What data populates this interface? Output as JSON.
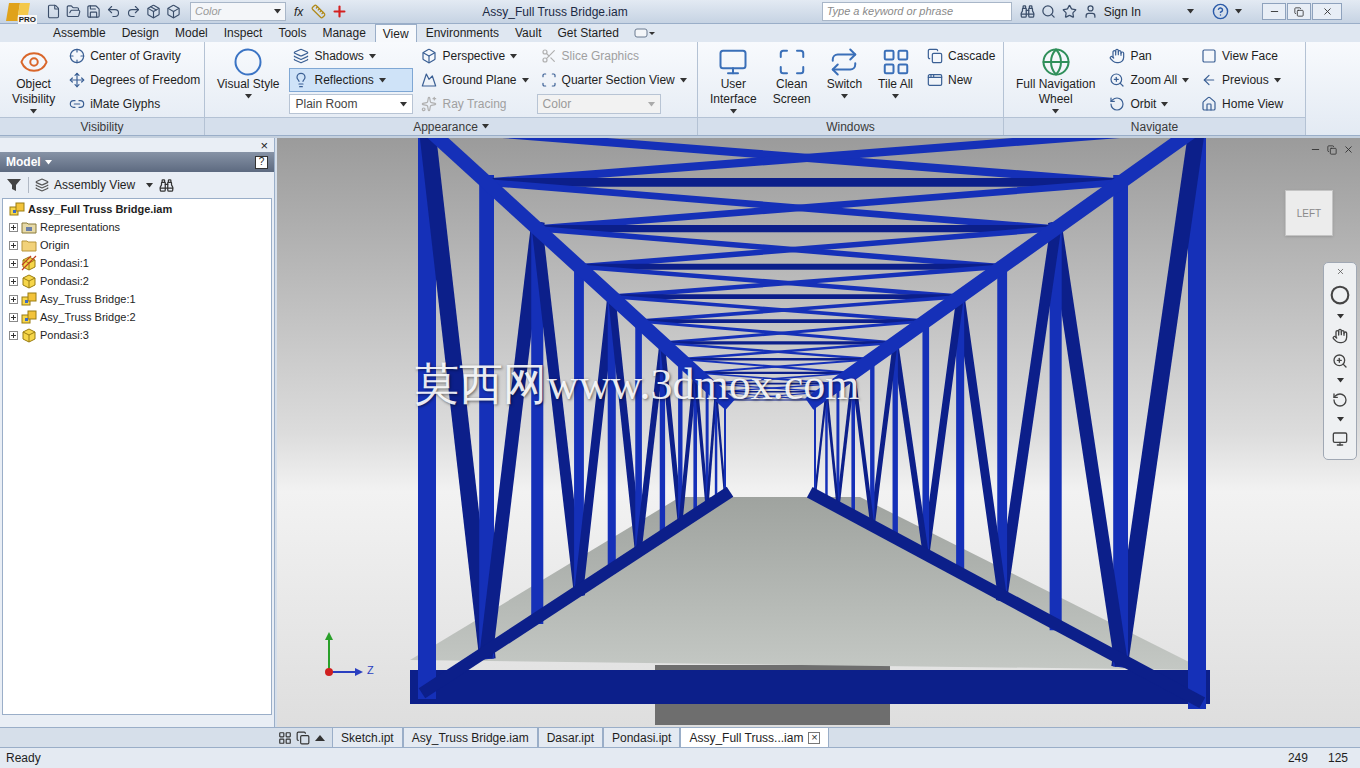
{
  "window": {
    "title": "Assy_Full Truss Bridge.iam",
    "app_badge": "PRO"
  },
  "quick_access": {
    "style_field": "Color",
    "function_label": "fx"
  },
  "search": {
    "placeholder": "Type a keyword or phrase"
  },
  "account": {
    "label": "Sign In"
  },
  "menu_tabs": [
    {
      "label": "Assemble",
      "selected": false
    },
    {
      "label": "Design",
      "selected": false
    },
    {
      "label": "Model",
      "selected": false
    },
    {
      "label": "Inspect",
      "selected": false
    },
    {
      "label": "Tools",
      "selected": false
    },
    {
      "label": "Manage",
      "selected": false
    },
    {
      "label": "View",
      "selected": true
    },
    {
      "label": "Environments",
      "selected": false
    },
    {
      "label": "Vault",
      "selected": false
    },
    {
      "label": "Get Started",
      "selected": false
    }
  ],
  "ribbon": {
    "panels": [
      {
        "label": "Visibility",
        "dropdown": false,
        "columns": [
          [
            {
              "kind": "large",
              "lines": [
                "Object",
                "Visibility"
              ],
              "dropdown": true,
              "active": false,
              "disabled": false
            }
          ],
          [
            {
              "kind": "small",
              "label": "Center of Gravity",
              "dropdown": false,
              "active": false,
              "disabled": false
            },
            {
              "kind": "small",
              "label": "Degrees of Freedom",
              "dropdown": false,
              "active": false,
              "disabled": false
            },
            {
              "kind": "small",
              "label": "iMate Glyphs",
              "dropdown": false,
              "active": false,
              "disabled": false
            }
          ]
        ]
      },
      {
        "label": "Appearance",
        "dropdown": true,
        "columns": [
          [
            {
              "kind": "large",
              "lines": [
                "Visual Style"
              ],
              "dropdown": true,
              "active": false,
              "disabled": false
            }
          ],
          [
            {
              "kind": "small",
              "label": "Shadows",
              "dropdown": true,
              "active": false,
              "disabled": false
            },
            {
              "kind": "small",
              "label": "Reflections",
              "dropdown": true,
              "active": true,
              "disabled": false
            },
            {
              "kind": "select",
              "label": "Plain Room",
              "dropdown": true,
              "active": false,
              "disabled": false
            }
          ],
          [
            {
              "kind": "small",
              "label": "Perspective",
              "dropdown": true,
              "active": false,
              "disabled": false
            },
            {
              "kind": "small",
              "label": "Ground Plane",
              "dropdown": true,
              "active": false,
              "disabled": false
            },
            {
              "kind": "small",
              "label": "Ray Tracing",
              "dropdown": false,
              "active": false,
              "disabled": true
            }
          ],
          [
            {
              "kind": "small",
              "label": "Slice Graphics",
              "dropdown": false,
              "active": false,
              "disabled": true
            },
            {
              "kind": "small",
              "label": "Quarter Section View",
              "dropdown": true,
              "active": false,
              "disabled": false
            },
            {
              "kind": "select",
              "label": "Color",
              "dropdown": true,
              "active": false,
              "disabled": true
            }
          ]
        ]
      },
      {
        "label": "Windows",
        "dropdown": false,
        "columns": [
          [
            {
              "kind": "large",
              "lines": [
                "User",
                "Interface"
              ],
              "dropdown": true,
              "active": false,
              "disabled": false
            }
          ],
          [
            {
              "kind": "large",
              "lines": [
                "Clean",
                "Screen"
              ],
              "dropdown": false,
              "active": false,
              "disabled": false
            }
          ],
          [
            {
              "kind": "large",
              "lines": [
                "Switch"
              ],
              "dropdown": true,
              "active": false,
              "disabled": false
            }
          ],
          [
            {
              "kind": "large",
              "lines": [
                "Tile All"
              ],
              "dropdown": true,
              "active": false,
              "disabled": false
            }
          ],
          [
            {
              "kind": "small",
              "label": "Cascade",
              "dropdown": false,
              "active": false,
              "disabled": false
            },
            {
              "kind": "small",
              "label": "New",
              "dropdown": false,
              "active": false,
              "disabled": false
            }
          ]
        ]
      },
      {
        "label": "Navigate",
        "dropdown": false,
        "columns": [
          [
            {
              "kind": "large",
              "lines": [
                "Full Navigation",
                "Wheel"
              ],
              "dropdown": true,
              "active": false,
              "disabled": false
            }
          ],
          [
            {
              "kind": "small",
              "label": "Pan",
              "dropdown": false,
              "active": false,
              "disabled": false
            },
            {
              "kind": "small",
              "label": "Zoom All",
              "dropdown": true,
              "active": false,
              "disabled": false
            },
            {
              "kind": "small",
              "label": "Orbit",
              "dropdown": true,
              "active": false,
              "disabled": false
            }
          ],
          [
            {
              "kind": "small",
              "label": "View Face",
              "dropdown": false,
              "active": false,
              "disabled": false
            },
            {
              "kind": "small",
              "label": "Previous",
              "dropdown": true,
              "active": false,
              "disabled": false
            },
            {
              "kind": "small",
              "label": "Home View",
              "dropdown": false,
              "active": false,
              "disabled": false
            }
          ]
        ]
      }
    ]
  },
  "browser": {
    "close": "×",
    "title": "Model",
    "help": "?",
    "view": "Assembly View",
    "tree": [
      {
        "label": "Assy_Full Truss Bridge.iam",
        "kind": "root",
        "active": true,
        "expanded": true
      },
      {
        "label": "Representations",
        "kind": "representations",
        "active": false,
        "expanded": false
      },
      {
        "label": "Origin",
        "kind": "folder",
        "active": false,
        "expanded": false
      },
      {
        "label": "Pondasi:1",
        "kind": "part-adaptive",
        "active": false,
        "expanded": false
      },
      {
        "label": "Pondasi:2",
        "kind": "part",
        "active": false,
        "expanded": false
      },
      {
        "label": "Asy_Truss Bridge:1",
        "kind": "assembly",
        "active": false,
        "expanded": false
      },
      {
        "label": "Asy_Truss Bridge:2",
        "kind": "assembly",
        "active": false,
        "expanded": false
      },
      {
        "label": "Pondasi:3",
        "kind": "part",
        "active": false,
        "expanded": false
      }
    ]
  },
  "viewport": {
    "viewcube": "LEFT",
    "axis_label": "Z",
    "watermark": "莫西网www.3dmox.com"
  },
  "document_tabs": [
    {
      "label": "Sketch.ipt",
      "selected": false,
      "closable": false
    },
    {
      "label": "Asy_Truss Bridge.iam",
      "selected": false,
      "closable": false
    },
    {
      "label": "Dasar.ipt",
      "selected": false,
      "closable": false
    },
    {
      "label": "Pondasi.ipt",
      "selected": false,
      "closable": false
    },
    {
      "label": "Assy_Full Truss...iam",
      "selected": true,
      "closable": true
    }
  ],
  "document_tab_close": "×",
  "status_bar": {
    "message": "Ready",
    "values": [
      "249",
      "125"
    ]
  }
}
